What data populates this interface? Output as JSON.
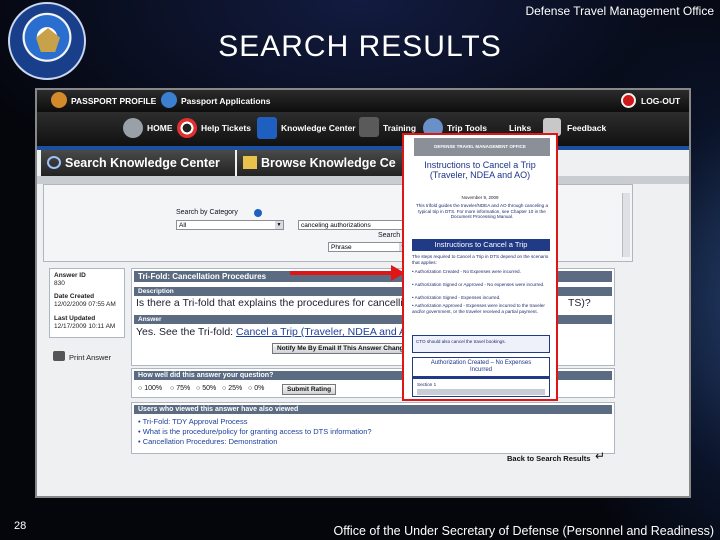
{
  "header": {
    "office": "Defense Travel Management Office",
    "title": "SEARCH RESULTS"
  },
  "footer": {
    "page_number": "28",
    "office": "Office of the Under Secretary of Defense (Personnel and Readiness)"
  },
  "nav_top": {
    "passport_profile": "PASSPORT PROFILE",
    "passport_apps": "Passport Applications",
    "logout": "LOG-OUT"
  },
  "nav_main": [
    "HOME",
    "Help Tickets",
    "Knowledge Center",
    "Training",
    "Trip Tools",
    "Links",
    "Feedback"
  ],
  "tabs": {
    "search": "Search Knowledge Center",
    "browse": "Browse Knowledge Ce"
  },
  "search": {
    "category_label": "Search by Category",
    "category_value": "All",
    "query_value": "canceling authorizations",
    "search_by_label": "Search By",
    "search_by_value": "Phrase"
  },
  "meta": {
    "answer_id_label": "Answer ID",
    "answer_id": "830",
    "created_label": "Date Created",
    "created": "12/02/2009 07:55 AM",
    "updated_label": "Last Updated",
    "updated": "12/17/2009 10:11 AM",
    "print": "Print Answer"
  },
  "answer": {
    "title": "Tri-Fold: Cancellation Procedures",
    "desc_label": "Description",
    "question_part1": "Is there a Tri-fold that explains the procedures for cancelling an autho",
    "question_part2": "TS)?",
    "answer_label": "Answer",
    "answer_prefix": "Yes. See the Tri-fold: ",
    "answer_link": "Cancel a Trip (Traveler, NDEA and AO)",
    "notify": "Notify Me By Email If This Answer Changes"
  },
  "rating": {
    "question": "How well did this answer your question?",
    "options": [
      "100%",
      "75%",
      "50%",
      "25%",
      "0%"
    ],
    "submit": "Submit Rating"
  },
  "also_viewed": {
    "header": "Users who viewed this answer have also viewed",
    "items": [
      "Tri-Fold: TDY Approval Process",
      "What is the procedure/policy for granting access to DTS information?",
      "Cancellation Procedures: Demonstration"
    ]
  },
  "back_link": "Back to Search Results",
  "doc": {
    "banner": "DEFENSE TRAVEL MANAGEMENT OFFICE",
    "title": "Instructions to Cancel a Trip (Traveler, NDEA and AO)",
    "date": "November 9, 2009",
    "intro": "This trifold guides the traveler/NDEA and AO through canceling a typical trip in DTS. For more information, see Chapter 10 in the Document Processing Manual.",
    "section_head": "Instructions to Cancel a Trip",
    "steps_intro": "The steps required to Cancel a Trip in DTS depend on the scenario that applies:",
    "bullets": [
      "Authorization Created - No Expenses were incurred.",
      "Authorization Signed or Approved - No expenses were incurred.",
      "Authorization Signed - Expenses incurred.",
      "Authorization Approved - Expenses were incurred to the traveler and/or government, or the traveler received a partial payment."
    ],
    "note": "CTO should also cancel the travel bookings.",
    "box_title": "Authorization Created – No Expenses Incurred",
    "box_section": "Section 1"
  },
  "colors": {
    "red": "#e01616",
    "nav_blue": "#1c4fa0",
    "panel_header": "#5a6b82"
  }
}
